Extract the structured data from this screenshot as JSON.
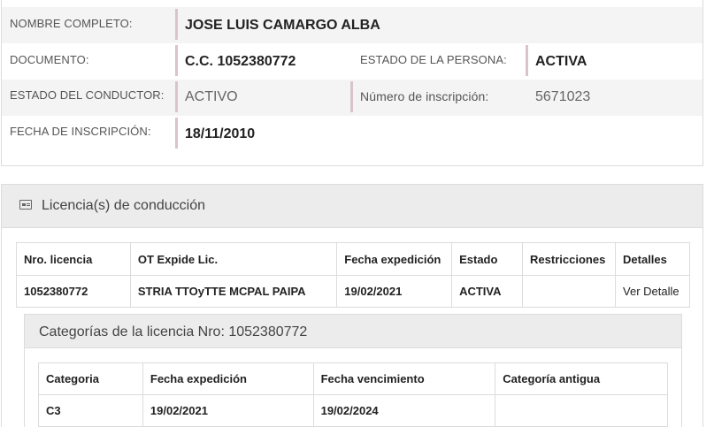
{
  "person": {
    "nombre_label": "NOMBRE COMPLETO:",
    "nombre_value": "JOSE LUIS CAMARGO ALBA",
    "documento_label": "DOCUMENTO:",
    "documento_value": "C.C. 1052380772",
    "estado_persona_label": "ESTADO DE LA PERSONA:",
    "estado_persona_value": "ACTIVA",
    "estado_conductor_label": "ESTADO DEL CONDUCTOR:",
    "estado_conductor_value": "ACTIVO",
    "num_inscripcion_label": "Número de inscripción:",
    "num_inscripcion_value": "5671023",
    "fecha_inscripcion_label": "FECHA DE INSCRIPCIÓN:",
    "fecha_inscripcion_value": "18/11/2010"
  },
  "licencias": {
    "title": "Licencia(s) de conducción",
    "icon": "id-card-icon",
    "columns": [
      "Nro. licencia",
      "OT Expide Lic.",
      "Fecha expedición",
      "Estado",
      "Restricciones",
      "Detalles"
    ],
    "rows": [
      {
        "nro": "1052380772",
        "ot": "STRIA TTOyTTE MCPAL PAIPA",
        "fecha": "19/02/2021",
        "estado": "ACTIVA",
        "restricciones": "",
        "detalles": "Ver Detalle"
      }
    ]
  },
  "categorias": {
    "title": "Categorías de la licencia Nro: 1052380772",
    "columns": [
      "Categoria",
      "Fecha expedición",
      "Fecha vencimiento",
      "Categoría antigua"
    ],
    "rows": [
      {
        "categoria": "C3",
        "expedicion": "19/02/2021",
        "vencimiento": "19/02/2024",
        "antigua": ""
      }
    ]
  },
  "colors": {
    "row_shade": "#f4f4f4",
    "divider_accent": "#d9c5c8",
    "header_bg": "#ececec",
    "border": "#dcdcdc"
  }
}
